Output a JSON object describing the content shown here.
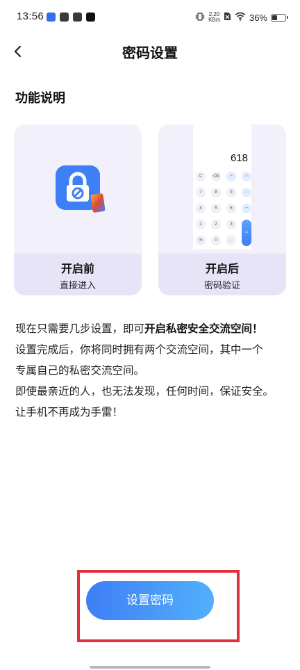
{
  "status_bar": {
    "time": "13:56",
    "net_speed_value": "2.20",
    "net_speed_unit": "KB/s",
    "battery": "36%",
    "battery_level": 0.36
  },
  "nav": {
    "back_icon": "chevron-left-icon",
    "title": "密码设置"
  },
  "section_title": "功能说明",
  "cards": [
    {
      "name": "开启前",
      "desc": "直接进入",
      "icon": "lock-app-icon"
    },
    {
      "name": "开启后",
      "desc": "密码验证",
      "calculator": {
        "display": "618",
        "keys": [
          "C",
          "⌫",
          "÷",
          "×",
          "7",
          "8",
          "9",
          "−",
          "4",
          "5",
          "6",
          "+",
          "1",
          "2",
          "3",
          "=",
          "%",
          "0",
          "."
        ]
      }
    }
  ],
  "description": {
    "line1_prefix": "现在只需要几步设置，即可",
    "line1_bold": "开启私密安全交流空间！",
    "line2": "设置完成后，你将同时拥有两个交流空间，其中一个",
    "line3": "专属自己的私密交流空间。",
    "line4": "即使最亲近的人，也无法发现，任何时间，保证安全。",
    "line5": "让手机不再成为手雷！"
  },
  "primary_button": "设置密码",
  "colors": {
    "accent": "#3d7ff5",
    "accent_light": "#52b0fb",
    "highlight_red": "#e0303c",
    "card_bg": "#f1f0fb",
    "card_footer_bg": "#e6e4f6"
  }
}
